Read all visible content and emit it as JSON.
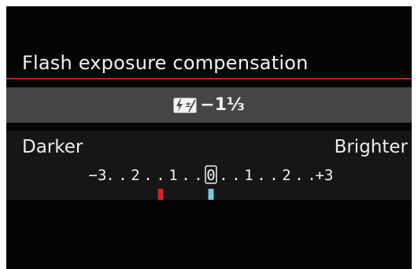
{
  "menu": {
    "title": "Flash exposure compensation"
  },
  "value": {
    "icon": "flash-exposure-compensation-icon",
    "text": "−1⅓",
    "stops": -1.3333
  },
  "scale": {
    "left_label": "Darker",
    "right_label": "Brighter",
    "ticks": [
      "−3",
      ".",
      ".",
      "2",
      ".",
      ".",
      "1",
      ".",
      ".",
      "0",
      ".",
      ".",
      "1",
      ".",
      ".",
      "2",
      ".",
      ".",
      "+3"
    ],
    "min": -3,
    "max": 3,
    "current_marker": -1.3333,
    "standard_marker": 0
  },
  "colors": {
    "background": "#050505",
    "accent_rule": "#b3202a",
    "value_bar": "#454545",
    "panel": "#161616",
    "current_marker": "#d6202c",
    "standard_marker": "#7cc7d6",
    "text": "#f1f1f1"
  }
}
